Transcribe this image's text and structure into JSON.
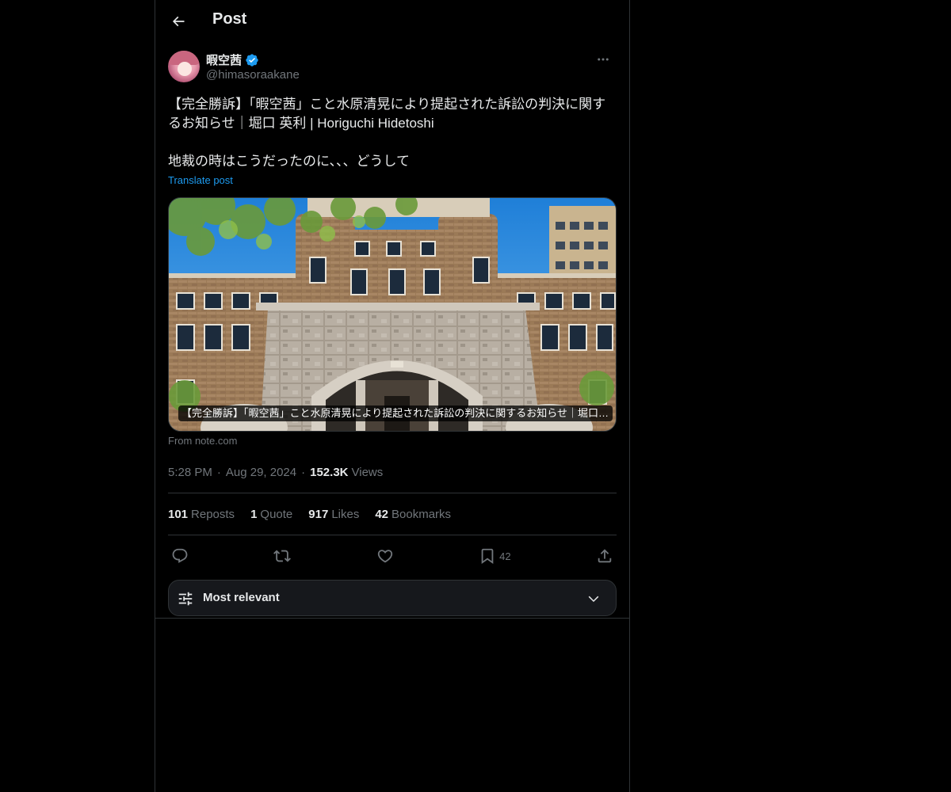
{
  "header": {
    "title": "Post"
  },
  "post": {
    "author": {
      "display_name": "暇空茜",
      "handle": "@himasoraakane"
    },
    "text_line1": "【完全勝訴】「暇空茜」こと水原清晃により提起された訴訟の判決に関するお知らせ｜堀口 英利 | Horiguchi Hidetoshi",
    "text_line2": "地裁の時はこうだったのに、、、どうして",
    "translate_label": "Translate post",
    "card": {
      "caption": "【完全勝訴】「暇空茜」こと水原清晃により提起された訴訟の判決に関するお知らせ｜堀口 英利 | Horiguchi Hidetoshi",
      "source": "From note.com"
    },
    "meta": {
      "time": "5:28 PM",
      "date": "Aug 29, 2024",
      "views_count": "152.3K",
      "views_label": "Views"
    },
    "stats": {
      "reposts_count": "101",
      "reposts_label": "Reposts",
      "quotes_count": "1",
      "quotes_label": "Quote",
      "likes_count": "917",
      "likes_label": "Likes",
      "bookmarks_count": "42",
      "bookmarks_label": "Bookmarks"
    },
    "actions": {
      "bookmark_count": "42"
    }
  },
  "sort": {
    "label": "Most relevant"
  },
  "colors": {
    "background": "#000000",
    "text": "#e7e9ea",
    "secondary_text": "#71767b",
    "accent": "#1d9bf0",
    "border": "#2f3336"
  }
}
